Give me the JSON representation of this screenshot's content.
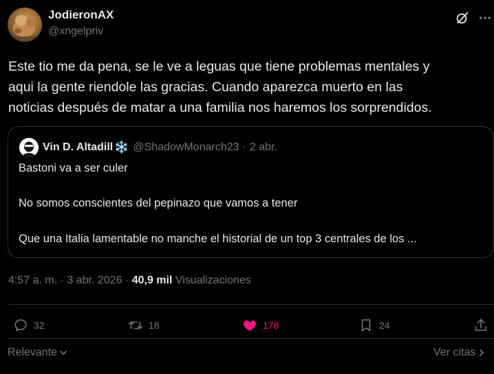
{
  "tweet": {
    "display_name": "JodieronAX",
    "handle": "@xngelpriv",
    "body_lines": [
      "Este tio me da pena, se le ve a leguas que tiene problemas mentales y",
      "aqui la gente riendole las gracias. Cuando aparezca muerto en las",
      "noticias después de matar a una familia nos haremos los sorprendidos."
    ],
    "icons": {
      "grok": "grok-icon",
      "more": "more-icon"
    }
  },
  "quote": {
    "display_name": "Vin D. Altadill",
    "badge": "❄️",
    "handle": "@ShadowMonarch23",
    "separator": "·",
    "date": "2 abr.",
    "lines": [
      "Bastoni va a ser culer",
      "No somos conscientes del pepinazo que vamos a tener",
      "Que una Italia lamentable no manche el historial de un top 3 centrales de los ..."
    ]
  },
  "meta": {
    "time": "4:57 a. m.",
    "separator": "·",
    "date": "3 abr. 2026",
    "separator2": "·",
    "views_count": "40,9 mil",
    "views_label": "Visualizaciones"
  },
  "actions": {
    "replies": "32",
    "reposts": "18",
    "likes": "178",
    "bookmarks": "24"
  },
  "footer": {
    "sort_label": "Relevante",
    "quotes_label": "Ver citas"
  },
  "colors": {
    "background": "#000000",
    "text": "#e7e9ea",
    "secondary": "#71767b",
    "border": "#2f3336",
    "like": "#f91880"
  }
}
